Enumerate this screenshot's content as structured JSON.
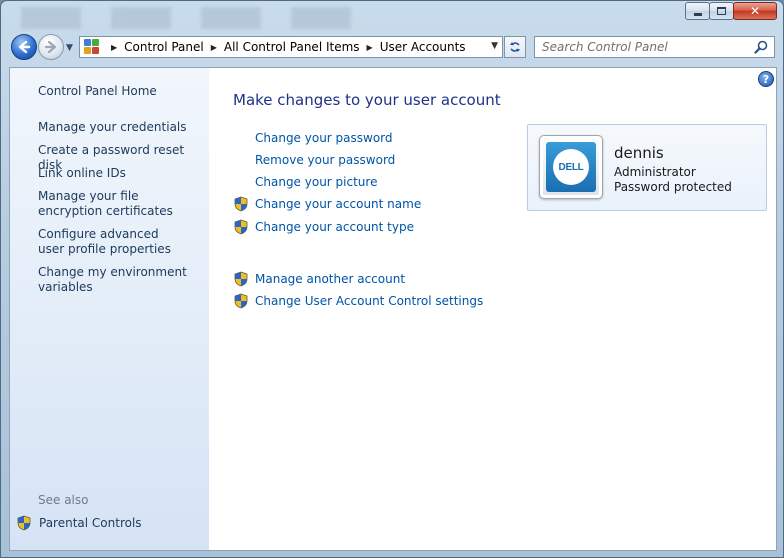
{
  "window": {
    "caption": {
      "minimize": "minimize",
      "maximize": "maximize",
      "close": "close"
    }
  },
  "navbar": {
    "breadcrumbs": [
      "Control Panel",
      "All Control Panel Items",
      "User Accounts"
    ],
    "search_placeholder": "Search Control Panel"
  },
  "sidebar": {
    "home": "Control Panel Home",
    "links": [
      "Manage your credentials",
      "Create a password reset disk",
      "Link online IDs",
      "Manage your file encryption certificates",
      "Configure advanced user profile properties",
      "Change my environment variables"
    ],
    "see_also_label": "See also",
    "parental_controls": "Parental Controls"
  },
  "main": {
    "title": "Make changes to your user account",
    "tasks": [
      {
        "label": "Change your password",
        "shield": false
      },
      {
        "label": "Remove your password",
        "shield": false
      },
      {
        "label": "Change your picture",
        "shield": false
      },
      {
        "label": "Change your account name",
        "shield": true
      },
      {
        "label": "Change your account type",
        "shield": true
      },
      {
        "label": "Manage another account",
        "shield": true
      },
      {
        "label": "Change User Account Control settings",
        "shield": true
      }
    ]
  },
  "user": {
    "name": "dennis",
    "role": "Administrator",
    "status": "Password protected",
    "avatar_logo_text": "DELL"
  },
  "colors": {
    "link": "#0054a6",
    "title": "#1e3287",
    "sidebar_link": "#1e395b",
    "sidebar_bg": "#e2ecf8"
  },
  "icons": {
    "back": "back-arrow-icon",
    "forward": "forward-arrow-icon",
    "refresh": "refresh-icon",
    "search": "search-icon",
    "help": "help-icon",
    "shield": "uac-shield-icon",
    "control_panel": "control-panel-icon"
  }
}
